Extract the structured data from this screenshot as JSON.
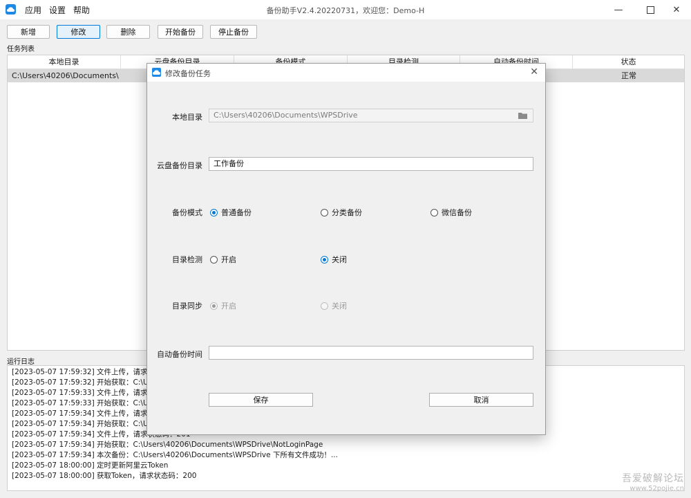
{
  "window": {
    "title": "备份助手V2.4.20220731，欢迎您：Demo-H",
    "menu": [
      "应用",
      "设置",
      "帮助"
    ]
  },
  "toolbar": {
    "add": "新增",
    "edit": "修改",
    "delete": "删除",
    "start": "开始备份",
    "stop": "停止备份"
  },
  "task_list": {
    "label": "任务列表",
    "columns": [
      "本地目录",
      "云盘备份目录",
      "备份模式",
      "目录检测",
      "自动备份时间",
      "状态"
    ],
    "rows": [
      {
        "local_dir": "C:\\Users\\40206\\Documents\\...",
        "status": "正常"
      }
    ]
  },
  "log": {
    "label": "运行日志",
    "lines": [
      "[2023-05-07 17:59:32] 文件上传，请求状",
      "[2023-05-07 17:59:32] 开始获取：C:\\Use",
      "[2023-05-07 17:59:33] 文件上传，请求状",
      "[2023-05-07 17:59:33] 开始获取：C:\\Use",
      "[2023-05-07 17:59:34] 文件上传，请求状",
      "[2023-05-07 17:59:34] 开始获取：C:\\Use",
      "[2023-05-07 17:59:34] 文件上传，请求状态码：201",
      "[2023-05-07 17:59:34] 开始获取：C:\\Users\\40206\\Documents\\WPSDrive\\NotLoginPage",
      "[2023-05-07 17:59:34] 本次备份：C:\\Users\\40206\\Documents\\WPSDrive 下所有文件成功！...",
      "[2023-05-07 18:00:00] 定时更新阿里云Token",
      "[2023-05-07 18:00:00] 获取Token，请求状态码：200"
    ]
  },
  "watermark": {
    "line1": "吾爱破解论坛",
    "line2": "www.52pojie.cn"
  },
  "dialog": {
    "title": "修改备份任务",
    "local_dir_label": "本地目录",
    "local_dir_value": "C:\\Users\\40206\\Documents\\WPSDrive",
    "cloud_dir_label": "云盘备份目录",
    "cloud_dir_value": "工作备份",
    "mode_label": "备份模式",
    "mode_options": [
      "普通备份",
      "分类备份",
      "微信备份"
    ],
    "check_label": "目录检测",
    "check_options": [
      "开启",
      "关闭"
    ],
    "sync_label": "目录同步",
    "sync_options": [
      "开启",
      "关闭"
    ],
    "auto_time_label": "自动备份时间",
    "auto_time_value": "",
    "save": "保存",
    "cancel": "取消"
  },
  "colors": {
    "accent": "#0078d7",
    "icon_blue": "#1e88e5"
  }
}
